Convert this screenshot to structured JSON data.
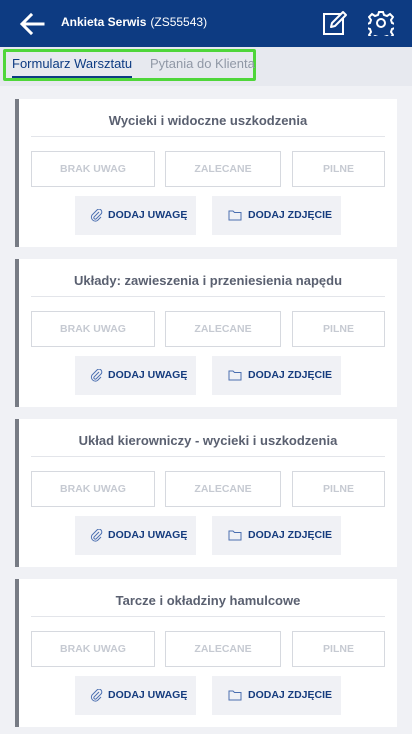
{
  "header": {
    "title": "Ankieta Serwis",
    "code": "(ZS55543)",
    "icons": {
      "back": "arrow-left-icon",
      "edit": "edit-icon",
      "settings": "gear-icon"
    },
    "background": "#0d3b82"
  },
  "tabs": [
    {
      "label": "Formularz Warsztatu",
      "active": true
    },
    {
      "label": "Pytania do Klienta",
      "active": false
    }
  ],
  "highlight_color": "#4fd63a",
  "options": {
    "none": "BRAK UWAG",
    "recommended": "ZALECANE",
    "urgent": "PILNE"
  },
  "actions": {
    "add_note": "DODAJ UWAGĘ",
    "add_photo": "DODAJ ZDJĘCIE",
    "note_icon": "paperclip-icon",
    "photo_icon": "folder-icon"
  },
  "sections": [
    {
      "title": "Wycieki i widoczne uszkodzenia"
    },
    {
      "title": "Układy: zawieszenia i przeniesienia napędu"
    },
    {
      "title": "Układ kierowniczy - wycieki i uszkodzenia"
    },
    {
      "title": "Tarcze i okładziny hamulcowe"
    }
  ]
}
